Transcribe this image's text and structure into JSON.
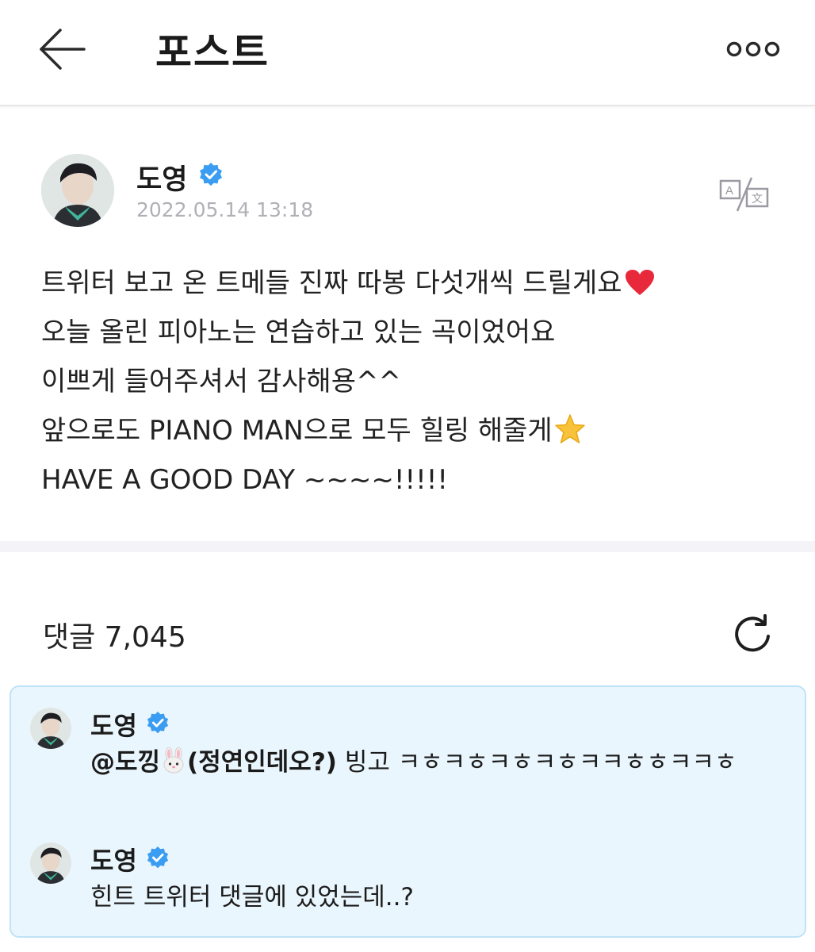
{
  "header": {
    "title": "포스트",
    "back_icon": "arrow-left-icon",
    "more_icon": "more-dots-icon"
  },
  "post": {
    "author": "도영",
    "date": "2022.05.14 13:18",
    "lines": [
      "트위터 보고 온 트메들 진짜 따봉 다섯개씩 드릴게요",
      "오늘 올린 피아노는 연습하고 있는 곡이었어요",
      "이쁘게 들어주셔서 감사해용^^",
      "앞으로도 PIANO MAN으로 모두 힐링 해줄게",
      "HAVE A GOOD DAY ~~~~!!!!!"
    ],
    "translate_icon": "translate-icon"
  },
  "comments_section": {
    "label": "댓글 7,045",
    "refresh_icon": "refresh-icon"
  },
  "comments": [
    {
      "author": "도영",
      "mention": "@도낑",
      "mention_suffix": "(정연인데오?)",
      "text": " 빙고 ㅋㅎㅋㅎㅋㅎㅋㅎㅋㅋㅎㅎㅋㅋㅎ"
    },
    {
      "author": "도영",
      "text": "힌트 트위터 댓글에 있었는데..?"
    }
  ],
  "colors": {
    "verified": "#3b9df2",
    "highlight_bg": "#eaf6fd",
    "highlight_border": "#bfe3f7",
    "date_gray": "#b0b0b6"
  }
}
